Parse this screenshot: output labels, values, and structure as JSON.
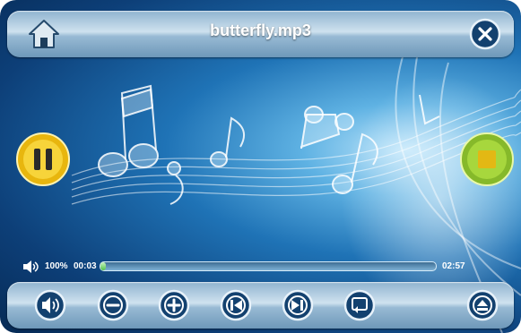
{
  "header": {
    "title": "butterfly.mp3",
    "home_icon": "home-icon",
    "close_icon": "close-icon"
  },
  "playback": {
    "pause_icon": "pause-icon",
    "stop_icon": "stop-icon",
    "volume_percent": "100%",
    "current_time": "00:03",
    "total_time": "02:57",
    "progress_fraction": 0.017
  },
  "controls": {
    "items": [
      {
        "name": "volume-button",
        "icon": "speaker-icon"
      },
      {
        "name": "minus-button",
        "icon": "minus-icon"
      },
      {
        "name": "plus-button",
        "icon": "plus-icon"
      },
      {
        "name": "previous-button",
        "icon": "skip-previous-icon"
      },
      {
        "name": "next-button",
        "icon": "skip-next-icon"
      },
      {
        "name": "repeat-button",
        "icon": "repeat-icon"
      },
      {
        "name": "eject-button",
        "icon": "eject-icon"
      }
    ]
  },
  "colors": {
    "accent_yellow": "#f3c81a",
    "accent_green": "#9ed23a",
    "progress_fill": "#4fc24a",
    "bar_dark": "#0f3a66"
  }
}
